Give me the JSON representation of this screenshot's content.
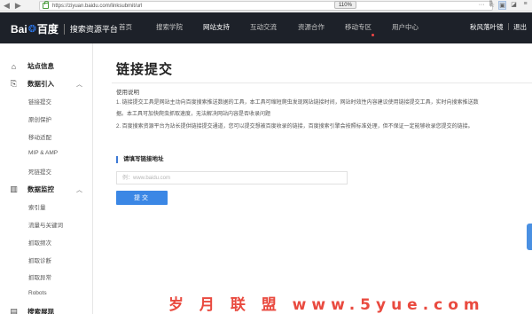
{
  "browser": {
    "url": "https://ziyuan.baidu.com/linksubmit/url",
    "zoom": "110%"
  },
  "topnav": {
    "logo_bai": "Bai",
    "logo_du": "百度",
    "logo_subtitle": "搜索资源平台",
    "items": [
      {
        "label": "首页"
      },
      {
        "label": "搜索学院"
      },
      {
        "label": "网站支持"
      },
      {
        "label": "互动交流"
      },
      {
        "label": "资源合作"
      },
      {
        "label": "移动专区"
      },
      {
        "label": "用户中心"
      }
    ],
    "username": "秋风落叶镜",
    "logout": "退出"
  },
  "sidebar": {
    "site_info": "站点信息",
    "groups": [
      {
        "label": "数据引入",
        "items": [
          "链接提交",
          "原创保护",
          "移动适配",
          "MIP & AMP",
          "死链提交"
        ]
      },
      {
        "label": "数据监控",
        "items": [
          "索引量",
          "流量与关键词",
          "抓取频次",
          "抓取诊断",
          "抓取异常",
          "Robots"
        ]
      },
      {
        "label": "搜索展现"
      }
    ]
  },
  "main": {
    "title": "链接提交",
    "usage_title": "使用说明",
    "usage_lines": [
      "1. 链接提交工具是网站主动向百度搜索推送数据的工具，本工具可缩短爬虫发现网站链接时间，网站时效性内容建议使用链接提交工具，实时向搜索推送数",
      "据。本工具可加快爬虫抓取速度，无法解决网站内容是否收录问题",
      "2. 百度搜索资源平台为站长提供链接提交通道，您可以提交想被百度收录的链接，百度搜索引擎会按照标准处理，但不保证一定能够收录您提交的链接。"
    ],
    "section_label": "请填写链接地址",
    "input_placeholder": "例：www.baidu.com",
    "submit_label": "提交"
  },
  "watermark": "岁 月 联 盟   www.5yue.com",
  "colors": {
    "topnav_bg": "#1d2129",
    "accent": "#3b87e5",
    "watermark": "#e94a3f"
  }
}
